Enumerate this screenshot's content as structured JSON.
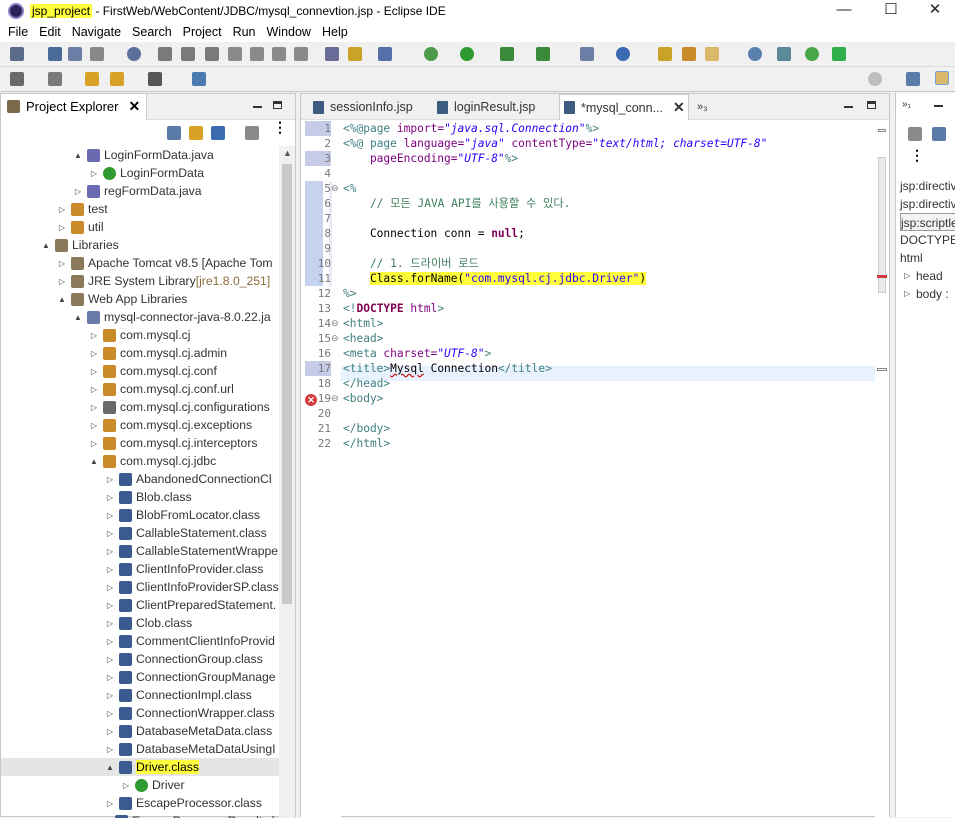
{
  "window": {
    "project_highlight": "jsp_project",
    "title_rest": " - FirstWeb/WebContent/JDBC/mysql_connevtion.jsp - Eclipse IDE",
    "minimize": "—",
    "maximize": "☐",
    "close": "✕"
  },
  "menu": [
    "File",
    "Edit",
    "Navigate",
    "Search",
    "Project",
    "Run",
    "Window",
    "Help"
  ],
  "explorer": {
    "tab_label": "Project Explorer",
    "tab_close": "✕",
    "tree": [
      {
        "label": "LoginFormData.java",
        "indent": 72,
        "twisty": "▲",
        "icon": "java",
        "decoration": ""
      },
      {
        "label": "LoginFormData",
        "indent": 88,
        "twisty": "▷",
        "icon": "class-green",
        "decoration": ""
      },
      {
        "label": "regFormData.java",
        "indent": 72,
        "twisty": "▷",
        "icon": "java",
        "decoration": ""
      },
      {
        "label": "test",
        "indent": 56,
        "twisty": "▷",
        "icon": "package",
        "decoration": ""
      },
      {
        "label": "util",
        "indent": 56,
        "twisty": "▷",
        "icon": "package",
        "decoration": ""
      },
      {
        "label": "Libraries",
        "indent": 40,
        "twisty": "▲",
        "icon": "library",
        "decoration": ""
      },
      {
        "label": "Apache Tomcat v8.5 [Apache Tom",
        "indent": 56,
        "twisty": "▷",
        "icon": "library",
        "decoration": ""
      },
      {
        "label": "JRE System Library ",
        "indent": 56,
        "twisty": "▷",
        "icon": "library",
        "decoration": "[jre1.8.0_251]"
      },
      {
        "label": "Web App Libraries",
        "indent": 56,
        "twisty": "▲",
        "icon": "library",
        "decoration": ""
      },
      {
        "label": "mysql-connector-java-8.0.22.ja",
        "indent": 72,
        "twisty": "▲",
        "icon": "jar",
        "decoration": ""
      },
      {
        "label": "com.mysql.cj",
        "indent": 88,
        "twisty": "▷",
        "icon": "pkg",
        "decoration": ""
      },
      {
        "label": "com.mysql.cj.admin",
        "indent": 88,
        "twisty": "▷",
        "icon": "pkg",
        "decoration": ""
      },
      {
        "label": "com.mysql.cj.conf",
        "indent": 88,
        "twisty": "▷",
        "icon": "pkg",
        "decoration": ""
      },
      {
        "label": "com.mysql.cj.conf.url",
        "indent": 88,
        "twisty": "▷",
        "icon": "pkg",
        "decoration": ""
      },
      {
        "label": "com.mysql.cj.configurations",
        "indent": 88,
        "twisty": "▷",
        "icon": "pkg2",
        "decoration": ""
      },
      {
        "label": "com.mysql.cj.exceptions",
        "indent": 88,
        "twisty": "▷",
        "icon": "pkg",
        "decoration": ""
      },
      {
        "label": "com.mysql.cj.interceptors",
        "indent": 88,
        "twisty": "▷",
        "icon": "pkg",
        "decoration": ""
      },
      {
        "label": "com.mysql.cj.jdbc",
        "indent": 88,
        "twisty": "▲",
        "icon": "pkg",
        "decoration": ""
      },
      {
        "label": "AbandonedConnectionCl",
        "indent": 104,
        "twisty": "▷",
        "icon": "classfile",
        "decoration": ""
      },
      {
        "label": "Blob.class",
        "indent": 104,
        "twisty": "▷",
        "icon": "classfile",
        "decoration": ""
      },
      {
        "label": "BlobFromLocator.class",
        "indent": 104,
        "twisty": "▷",
        "icon": "classfile",
        "decoration": ""
      },
      {
        "label": "CallableStatement.class",
        "indent": 104,
        "twisty": "▷",
        "icon": "classfile",
        "decoration": ""
      },
      {
        "label": "CallableStatementWrappe",
        "indent": 104,
        "twisty": "▷",
        "icon": "classfile",
        "decoration": ""
      },
      {
        "label": "ClientInfoProvider.class",
        "indent": 104,
        "twisty": "▷",
        "icon": "classfile",
        "decoration": ""
      },
      {
        "label": "ClientInfoProviderSP.class",
        "indent": 104,
        "twisty": "▷",
        "icon": "classfile",
        "decoration": ""
      },
      {
        "label": "ClientPreparedStatement.",
        "indent": 104,
        "twisty": "▷",
        "icon": "classfile",
        "decoration": ""
      },
      {
        "label": "Clob.class",
        "indent": 104,
        "twisty": "▷",
        "icon": "classfile",
        "decoration": ""
      },
      {
        "label": "CommentClientInfoProvid",
        "indent": 104,
        "twisty": "▷",
        "icon": "classfile",
        "decoration": ""
      },
      {
        "label": "ConnectionGroup.class",
        "indent": 104,
        "twisty": "▷",
        "icon": "classfile",
        "decoration": ""
      },
      {
        "label": "ConnectionGroupManage",
        "indent": 104,
        "twisty": "▷",
        "icon": "classfile",
        "decoration": ""
      },
      {
        "label": "ConnectionImpl.class",
        "indent": 104,
        "twisty": "▷",
        "icon": "classfile",
        "decoration": ""
      },
      {
        "label": "ConnectionWrapper.class",
        "indent": 104,
        "twisty": "▷",
        "icon": "classfile",
        "decoration": ""
      },
      {
        "label": "DatabaseMetaData.class",
        "indent": 104,
        "twisty": "▷",
        "icon": "classfile",
        "decoration": ""
      },
      {
        "label": "DatabaseMetaDataUsingI",
        "indent": 104,
        "twisty": "▷",
        "icon": "classfile",
        "decoration": ""
      },
      {
        "label": "Driver.class",
        "indent": 104,
        "twisty": "▲",
        "icon": "classfile",
        "decoration": "",
        "selected": true
      },
      {
        "label": "Driver",
        "indent": 120,
        "twisty": "▷",
        "icon": "class-green",
        "decoration": ""
      },
      {
        "label": "EscapeProcessor.class",
        "indent": 104,
        "twisty": "▷",
        "icon": "classfile",
        "decoration": ""
      },
      {
        "label": "EscapeProcessorResult.cla",
        "indent": 104,
        "twisty": "▷",
        "icon": "classfile",
        "decoration": ""
      }
    ]
  },
  "editor": {
    "tabs": [
      {
        "label": "sessionInfo.jsp",
        "active": false
      },
      {
        "label": "loginResult.jsp",
        "active": false
      },
      {
        "label": "*mysql_conn...",
        "active": true
      }
    ],
    "tab_close": "✕",
    "overflow_label": "»₃",
    "line_numbers": [
      "1",
      "2",
      "3",
      "4",
      "5",
      "6",
      "7",
      "8",
      "9",
      "10",
      "11",
      "12",
      "13",
      "14",
      "15",
      "16",
      "17",
      "18",
      "19",
      "20",
      "21",
      "22"
    ]
  },
  "code": {
    "l1_dir": "<%@",
    "l1_kw": "page",
    "l1_attr": " import=",
    "l1_val": "\"java.sql.Connection\"",
    "l1_end": "%>",
    "l2_dir": "<%@",
    "l2_kw": " page",
    "l2_a1": " language=",
    "l2_v1": "\"java\"",
    "l2_a2": " contentType=",
    "l2_v2": "\"text/html; charset=UTF-8\"",
    "l3_a": "    pageEncoding=",
    "l3_v": "\"UTF-8\"",
    "l3_end": "%>",
    "l5": "<%",
    "l6": "    // 모든 JAVA API를 사용할 수 있다.",
    "l8_a": "    Connection conn = ",
    "l8_kw": "null",
    "l8_b": ";",
    "l10": "    // 1. 드라이버 로드",
    "l11_a": "Class.forName(",
    "l11_s": "\"com.mysql.cj.jdbc.Driver\"",
    "l11_b": ")",
    "l11_pre": "    ",
    "l12": "%>",
    "l13_a": "<!",
    "l13_kw": "DOCTYPE",
    "l13_b": " html",
    "l13_c": ">",
    "l14": "<html>",
    "l15": "<head>",
    "l16_t": "<meta",
    "l16_a": " charset=",
    "l16_v": "\"UTF-8\"",
    "l16_e": ">",
    "l17_t1": "<title>",
    "l17_sq": "Mysql",
    "l17_txt": " Connection",
    "l17_t2": "</title>",
    "l18": "</head>",
    "l19": "<body>",
    "l21": "</body>",
    "l22": "</html>"
  },
  "outline": {
    "rows": [
      "jsp:directive",
      "jsp:directive",
      "jsp:scriptle",
      "DOCTYPE:",
      "html",
      "head",
      "body :"
    ]
  },
  "colors": {
    "highlight": "#ffff3c",
    "tag": "#3f7f7f",
    "keyword": "#7f0055",
    "string": "#2a00ff",
    "comment": "#3f7f5f"
  }
}
